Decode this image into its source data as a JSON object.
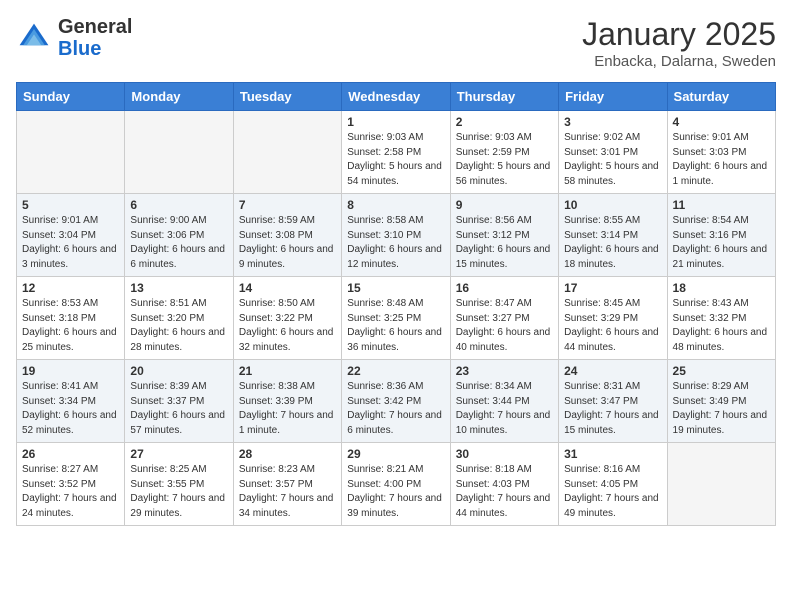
{
  "header": {
    "logo_general": "General",
    "logo_blue": "Blue",
    "month_title": "January 2025",
    "subtitle": "Enbacka, Dalarna, Sweden"
  },
  "weekdays": [
    "Sunday",
    "Monday",
    "Tuesday",
    "Wednesday",
    "Thursday",
    "Friday",
    "Saturday"
  ],
  "weeks": [
    [
      {
        "day": "",
        "sunrise": "",
        "sunset": "",
        "daylight": ""
      },
      {
        "day": "",
        "sunrise": "",
        "sunset": "",
        "daylight": ""
      },
      {
        "day": "",
        "sunrise": "",
        "sunset": "",
        "daylight": ""
      },
      {
        "day": "1",
        "sunrise": "Sunrise: 9:03 AM",
        "sunset": "Sunset: 2:58 PM",
        "daylight": "Daylight: 5 hours and 54 minutes."
      },
      {
        "day": "2",
        "sunrise": "Sunrise: 9:03 AM",
        "sunset": "Sunset: 2:59 PM",
        "daylight": "Daylight: 5 hours and 56 minutes."
      },
      {
        "day": "3",
        "sunrise": "Sunrise: 9:02 AM",
        "sunset": "Sunset: 3:01 PM",
        "daylight": "Daylight: 5 hours and 58 minutes."
      },
      {
        "day": "4",
        "sunrise": "Sunrise: 9:01 AM",
        "sunset": "Sunset: 3:03 PM",
        "daylight": "Daylight: 6 hours and 1 minute."
      }
    ],
    [
      {
        "day": "5",
        "sunrise": "Sunrise: 9:01 AM",
        "sunset": "Sunset: 3:04 PM",
        "daylight": "Daylight: 6 hours and 3 minutes."
      },
      {
        "day": "6",
        "sunrise": "Sunrise: 9:00 AM",
        "sunset": "Sunset: 3:06 PM",
        "daylight": "Daylight: 6 hours and 6 minutes."
      },
      {
        "day": "7",
        "sunrise": "Sunrise: 8:59 AM",
        "sunset": "Sunset: 3:08 PM",
        "daylight": "Daylight: 6 hours and 9 minutes."
      },
      {
        "day": "8",
        "sunrise": "Sunrise: 8:58 AM",
        "sunset": "Sunset: 3:10 PM",
        "daylight": "Daylight: 6 hours and 12 minutes."
      },
      {
        "day": "9",
        "sunrise": "Sunrise: 8:56 AM",
        "sunset": "Sunset: 3:12 PM",
        "daylight": "Daylight: 6 hours and 15 minutes."
      },
      {
        "day": "10",
        "sunrise": "Sunrise: 8:55 AM",
        "sunset": "Sunset: 3:14 PM",
        "daylight": "Daylight: 6 hours and 18 minutes."
      },
      {
        "day": "11",
        "sunrise": "Sunrise: 8:54 AM",
        "sunset": "Sunset: 3:16 PM",
        "daylight": "Daylight: 6 hours and 21 minutes."
      }
    ],
    [
      {
        "day": "12",
        "sunrise": "Sunrise: 8:53 AM",
        "sunset": "Sunset: 3:18 PM",
        "daylight": "Daylight: 6 hours and 25 minutes."
      },
      {
        "day": "13",
        "sunrise": "Sunrise: 8:51 AM",
        "sunset": "Sunset: 3:20 PM",
        "daylight": "Daylight: 6 hours and 28 minutes."
      },
      {
        "day": "14",
        "sunrise": "Sunrise: 8:50 AM",
        "sunset": "Sunset: 3:22 PM",
        "daylight": "Daylight: 6 hours and 32 minutes."
      },
      {
        "day": "15",
        "sunrise": "Sunrise: 8:48 AM",
        "sunset": "Sunset: 3:25 PM",
        "daylight": "Daylight: 6 hours and 36 minutes."
      },
      {
        "day": "16",
        "sunrise": "Sunrise: 8:47 AM",
        "sunset": "Sunset: 3:27 PM",
        "daylight": "Daylight: 6 hours and 40 minutes."
      },
      {
        "day": "17",
        "sunrise": "Sunrise: 8:45 AM",
        "sunset": "Sunset: 3:29 PM",
        "daylight": "Daylight: 6 hours and 44 minutes."
      },
      {
        "day": "18",
        "sunrise": "Sunrise: 8:43 AM",
        "sunset": "Sunset: 3:32 PM",
        "daylight": "Daylight: 6 hours and 48 minutes."
      }
    ],
    [
      {
        "day": "19",
        "sunrise": "Sunrise: 8:41 AM",
        "sunset": "Sunset: 3:34 PM",
        "daylight": "Daylight: 6 hours and 52 minutes."
      },
      {
        "day": "20",
        "sunrise": "Sunrise: 8:39 AM",
        "sunset": "Sunset: 3:37 PM",
        "daylight": "Daylight: 6 hours and 57 minutes."
      },
      {
        "day": "21",
        "sunrise": "Sunrise: 8:38 AM",
        "sunset": "Sunset: 3:39 PM",
        "daylight": "Daylight: 7 hours and 1 minute."
      },
      {
        "day": "22",
        "sunrise": "Sunrise: 8:36 AM",
        "sunset": "Sunset: 3:42 PM",
        "daylight": "Daylight: 7 hours and 6 minutes."
      },
      {
        "day": "23",
        "sunrise": "Sunrise: 8:34 AM",
        "sunset": "Sunset: 3:44 PM",
        "daylight": "Daylight: 7 hours and 10 minutes."
      },
      {
        "day": "24",
        "sunrise": "Sunrise: 8:31 AM",
        "sunset": "Sunset: 3:47 PM",
        "daylight": "Daylight: 7 hours and 15 minutes."
      },
      {
        "day": "25",
        "sunrise": "Sunrise: 8:29 AM",
        "sunset": "Sunset: 3:49 PM",
        "daylight": "Daylight: 7 hours and 19 minutes."
      }
    ],
    [
      {
        "day": "26",
        "sunrise": "Sunrise: 8:27 AM",
        "sunset": "Sunset: 3:52 PM",
        "daylight": "Daylight: 7 hours and 24 minutes."
      },
      {
        "day": "27",
        "sunrise": "Sunrise: 8:25 AM",
        "sunset": "Sunset: 3:55 PM",
        "daylight": "Daylight: 7 hours and 29 minutes."
      },
      {
        "day": "28",
        "sunrise": "Sunrise: 8:23 AM",
        "sunset": "Sunset: 3:57 PM",
        "daylight": "Daylight: 7 hours and 34 minutes."
      },
      {
        "day": "29",
        "sunrise": "Sunrise: 8:21 AM",
        "sunset": "Sunset: 4:00 PM",
        "daylight": "Daylight: 7 hours and 39 minutes."
      },
      {
        "day": "30",
        "sunrise": "Sunrise: 8:18 AM",
        "sunset": "Sunset: 4:03 PM",
        "daylight": "Daylight: 7 hours and 44 minutes."
      },
      {
        "day": "31",
        "sunrise": "Sunrise: 8:16 AM",
        "sunset": "Sunset: 4:05 PM",
        "daylight": "Daylight: 7 hours and 49 minutes."
      },
      {
        "day": "",
        "sunrise": "",
        "sunset": "",
        "daylight": ""
      }
    ]
  ]
}
